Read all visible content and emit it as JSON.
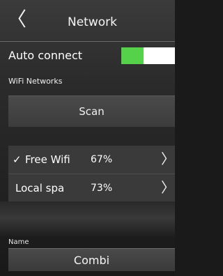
{
  "header": {
    "back_glyph": "〈",
    "title": "Network"
  },
  "auto_connect": {
    "label": "Auto connect",
    "enabled": true,
    "toggle_color": "#56d24a"
  },
  "wifi": {
    "section_label": "WiFi Networks",
    "scan_label": "Scan",
    "networks": [
      {
        "connected": true,
        "check_glyph": "✓",
        "name": "Free Wifi",
        "signal": "67%",
        "arrow": "〉"
      },
      {
        "connected": false,
        "check_glyph": "",
        "name": "Local spa",
        "signal": "73%",
        "arrow": "〉"
      }
    ]
  },
  "name": {
    "label": "Name",
    "value": "Combi"
  }
}
